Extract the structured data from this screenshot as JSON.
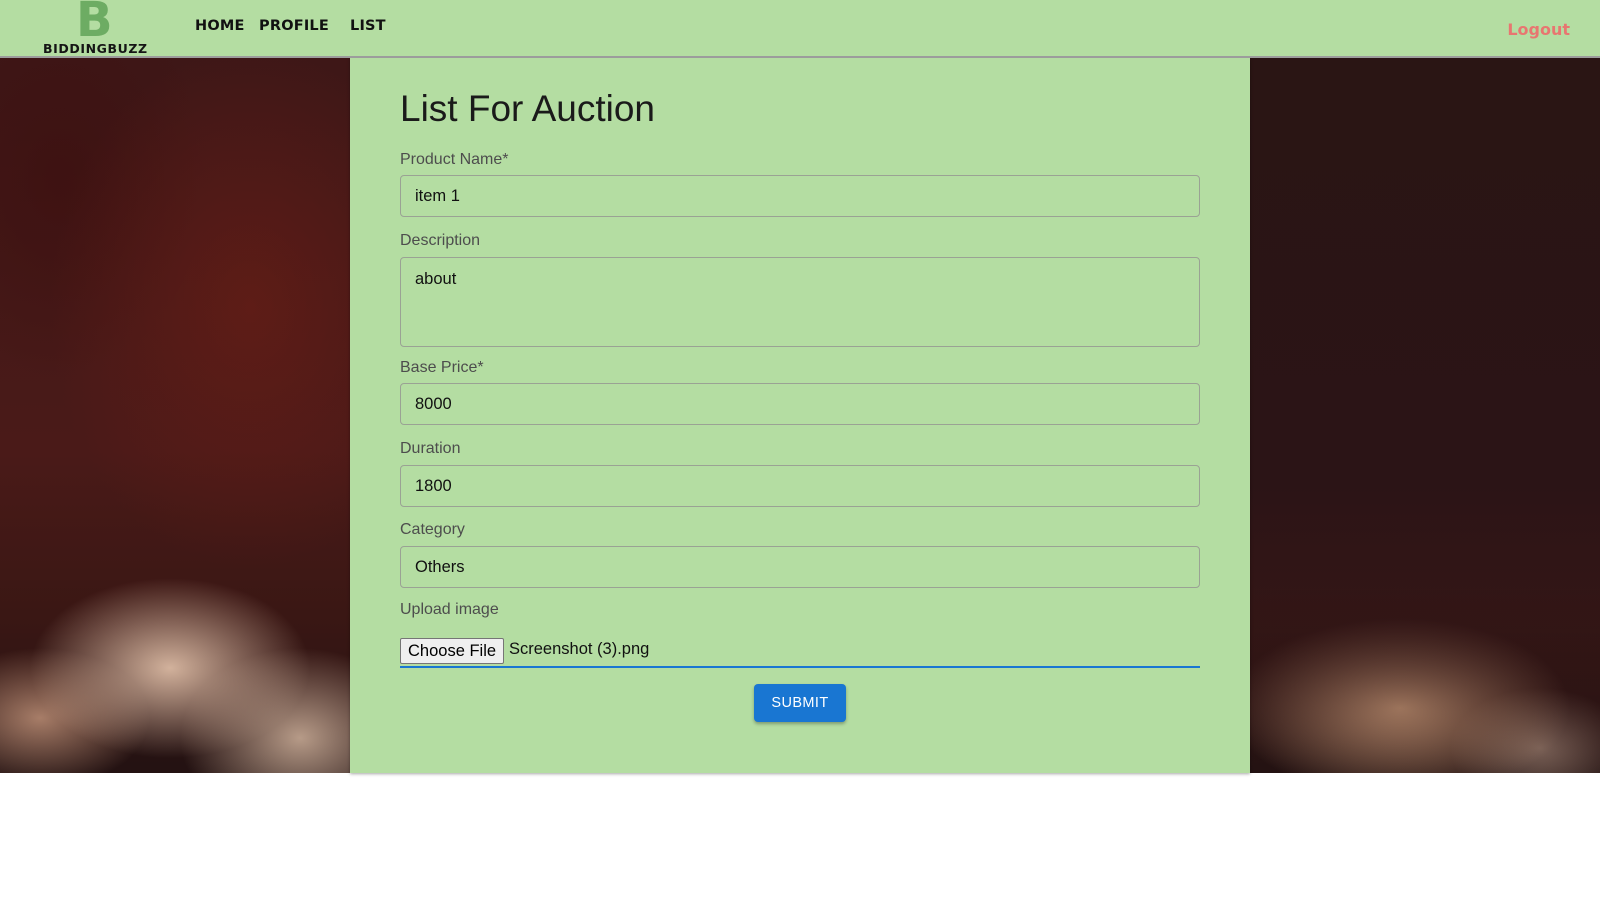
{
  "brand": {
    "logo_letter": "B",
    "logo_text": "BIDDINGBUZZ"
  },
  "nav": {
    "items": [
      {
        "label": "HOME"
      },
      {
        "label": "PROFILE"
      },
      {
        "label": "LIST"
      }
    ],
    "logout_label": "Logout"
  },
  "form": {
    "title": "List For Auction",
    "product_name": {
      "label": "Product Name*",
      "value": "item 1"
    },
    "description": {
      "label": "Description",
      "value": "about"
    },
    "base_price": {
      "label": "Base Price*",
      "value": "8000"
    },
    "duration": {
      "label": "Duration",
      "value": "1800"
    },
    "category": {
      "label": "Category",
      "value": "Others"
    },
    "upload": {
      "label": "Upload image",
      "button_label": "Choose File",
      "file_name": "Screenshot (3).png"
    },
    "submit_label": "SUBMIT"
  },
  "colors": {
    "panel_green": "#b4dda2",
    "logo_green": "#6dac63",
    "logout_red": "#e87670",
    "primary_blue": "#1976d2"
  }
}
